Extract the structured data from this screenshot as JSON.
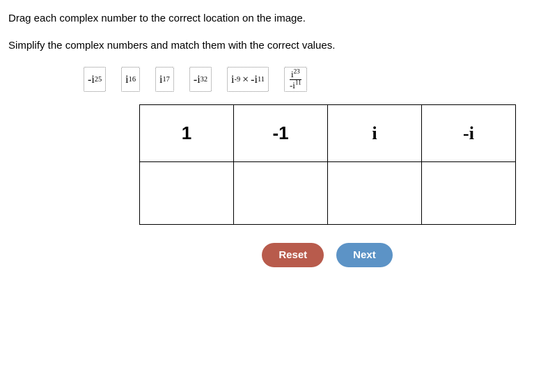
{
  "instructions": {
    "line1": "Drag each complex number to the correct location on the image.",
    "line2": "Simplify the complex numbers and match them with the correct values."
  },
  "tokens": [
    {
      "id": "tok1",
      "base": "-i",
      "exp": "25"
    },
    {
      "id": "tok2",
      "base": "i",
      "exp": "16"
    },
    {
      "id": "tok3",
      "base": "i",
      "exp": "17"
    },
    {
      "id": "tok4",
      "base": "-i",
      "exp": "32"
    },
    {
      "id": "tok5",
      "a_base": "i",
      "a_exp": "-9",
      "op": "×",
      "b_base": "-i",
      "b_exp": "11"
    },
    {
      "id": "tok6",
      "num_base": "i",
      "num_exp": "23",
      "den_base": "-i",
      "den_exp": "11"
    }
  ],
  "grid": {
    "headers": [
      "1",
      "-1",
      "i",
      "-i"
    ]
  },
  "buttons": {
    "reset": "Reset",
    "next": "Next"
  }
}
